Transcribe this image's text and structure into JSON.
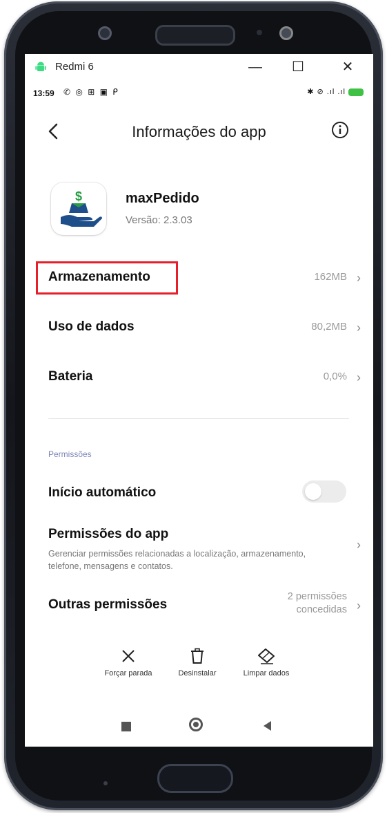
{
  "window": {
    "title": "Redmi 6",
    "minimize_glyph": "—",
    "maximize_glyph": "☐",
    "close_glyph": "✕"
  },
  "status_bar": {
    "time": "13:59",
    "left_icons": "✆ ◎ ⊞ ▣ ᑭ",
    "right_icons": "✱ ⊘ .ıl .ıl"
  },
  "header": {
    "title": "Informações do app",
    "back_icon": "chevron-left-icon",
    "info_icon": "info-icon"
  },
  "app": {
    "name": "maxPedido",
    "version": "Versão: 2.3.03",
    "icon": "hand-money-box-icon"
  },
  "rows": [
    {
      "label": "Armazenamento",
      "value": "162MB"
    },
    {
      "label": "Uso de dados",
      "value": "80,2MB"
    },
    {
      "label": "Bateria",
      "value": "0,0%"
    }
  ],
  "permissions": {
    "section_label": "Permissões",
    "autostart_label": "Início automático",
    "autostart_enabled": false,
    "app_permissions_title": "Permissões do app",
    "app_permissions_desc": "Gerenciar permissões relacionadas a localização, armazenamento, telefone, mensagens e contatos.",
    "other_label": "Outras permissões",
    "other_value": "2 permissões concedidas"
  },
  "actions": [
    {
      "label": "Forçar parada",
      "icon": "close-icon"
    },
    {
      "label": "Desinstalar",
      "icon": "trash-icon"
    },
    {
      "label": "Limpar dados",
      "icon": "eraser-icon"
    }
  ],
  "chevron": "›",
  "colors": {
    "highlight": "#e5202a",
    "section_label": "#7e86b8",
    "battery": "#3ec144",
    "app_icon_blue": "#1f4f8b",
    "app_icon_green": "#2a9d46"
  }
}
